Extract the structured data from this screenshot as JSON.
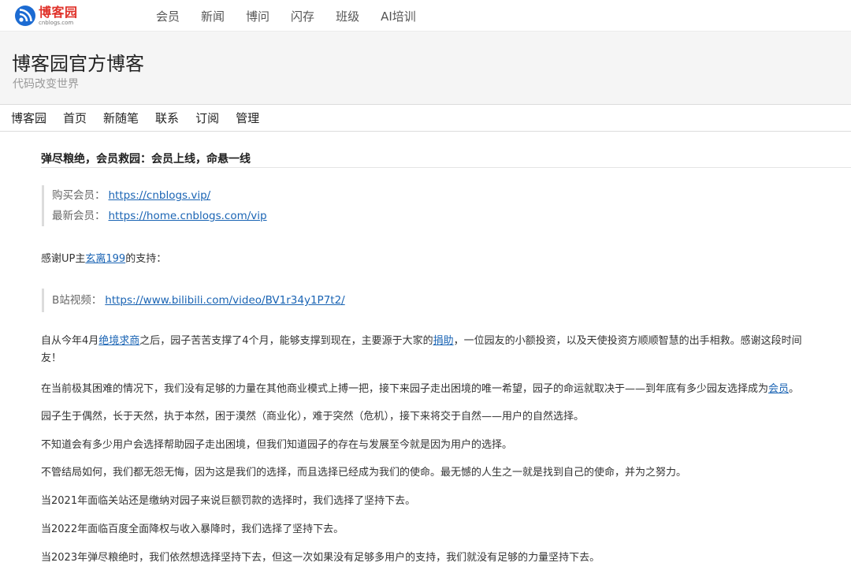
{
  "top_nav": {
    "logo_name": "博客园",
    "logo_domain": "cnblogs.com",
    "items": [
      "会员",
      "新闻",
      "博问",
      "闪存",
      "班级",
      "AI培训"
    ]
  },
  "header": {
    "title": "博客园官方博客",
    "subtitle": "代码改变世界"
  },
  "blog_nav": {
    "items": [
      "博客园",
      "首页",
      "新随笔",
      "联系",
      "订阅",
      "管理"
    ]
  },
  "post": {
    "title": "弹尽粮绝，会员救园：会员上线，命悬一线",
    "quote1": {
      "buy_label": "购买会员：",
      "buy_link": "https://cnblogs.vip/",
      "new_label": "最新会员：",
      "new_link": "https://home.cnblogs.com/vip"
    },
    "thanks": {
      "prefix": "感谢UP主",
      "link": "玄离199",
      "suffix": "的支持："
    },
    "quote2": {
      "label": "B站视频：",
      "link": "https://www.bilibili.com/video/BV1r34y1P7t2/"
    },
    "p1": {
      "a": "自从今年4月",
      "link1": "绝境求商",
      "b": "之后，园子苦苦支撑了4个月，能够支撑到现在，主要源于大家的",
      "link2": "捐助",
      "c": "，一位园友的小额投资，以及天使投资方顺顺智慧的出手相救。感谢这段时间",
      "d": "友！"
    },
    "p2": {
      "a": "在当前极其困难的情况下，我们没有足够的力量在其他商业模式上搏一把，接下来园子走出困境的唯一希望，园子的命运就取决于——到年底有多少园友选择成为",
      "link": "会员",
      "b": "。"
    },
    "p3": "园子生于偶然，长于天然，执于本然，困于漠然（商业化），难于突然（危机），接下来将交于自然——用户的自然选择。",
    "p4": "不知道会有多少用户会选择帮助园子走出困境，但我们知道园子的存在与发展至今就是因为用户的选择。",
    "p5": "不管结局如何，我们都无怨无悔，因为这是我们的选择，而且选择已经成为我们的使命。最无憾的人生之一就是找到自己的使命，并为之努力。",
    "p6": "当2021年面临关站还是缴纳对园子来说巨额罚款的选择时，我们选择了坚持下去。",
    "p7": "当2022年面临百度全面降权与收入暴降时，我们选择了坚持下去。",
    "p8": "当2023年弹尽粮绝时，我们依然想选择坚持下去，但这一次如果没有足够多用户的支持，我们就没有足够的力量坚持下去。"
  },
  "colors": {
    "link": "#1a64b4",
    "logo_red": "#e0322a",
    "logo_blue": "#1c6bd2",
    "header_bg": "#f5f5f5"
  }
}
